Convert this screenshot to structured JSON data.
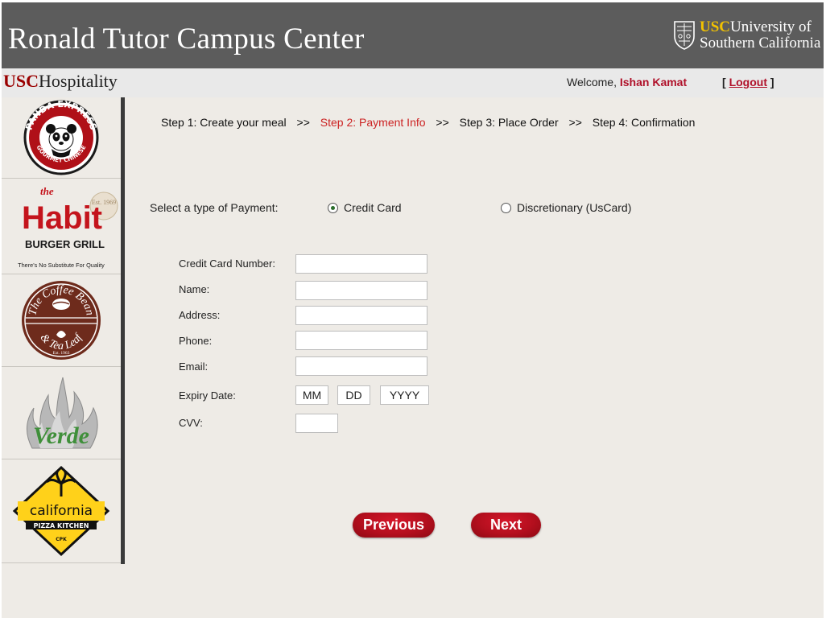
{
  "header": {
    "title": "Ronald Tutor Campus Center",
    "logo_usc": "USC",
    "logo_line1": "University of",
    "logo_line2": "Southern California"
  },
  "subbar": {
    "brand_usc": "USC",
    "brand_name": "Hospitality",
    "welcome_prefix": "Welcome, ",
    "user_name": "Ishan Kamat",
    "logout_open": "[ ",
    "logout_label": "Logout",
    "logout_close": " ]"
  },
  "sidebar": {
    "items": [
      {
        "name": "Panda Express",
        "line1": "PANDA EXPRESS",
        "line2": "GOURMET CHINESE"
      },
      {
        "name": "The Habit",
        "line1": "the",
        "line2": "Habit",
        "line3": "BURGER GRILL",
        "line4": "There's No Substitute For Quality",
        "badge": "Est. 1969"
      },
      {
        "name": "The Coffee Bean & Tea Leaf",
        "line1": "The Coffee Bean",
        "line2": "& Tea Leaf",
        "line3": "Est. 1963"
      },
      {
        "name": "Verde",
        "line1": "Verde"
      },
      {
        "name": "California Pizza Kitchen",
        "line1": "california",
        "line2": "PIZZA KITCHEN",
        "line3": "CPK"
      }
    ]
  },
  "steps": {
    "step1": "Step 1: Create your meal",
    "sep": ">>",
    "step2": "Step 2: Payment Info",
    "step3": "Step 3: Place Order",
    "step4": "Step 4: Confirmation"
  },
  "payment": {
    "label": "Select a type of Payment:",
    "options": [
      "Credit Card",
      "Discretionary (UsCard)"
    ],
    "selected": "Credit Card"
  },
  "form": {
    "card_number_label": "Credit Card Number:",
    "name_label": "Name:",
    "address_label": "Address:",
    "phone_label": "Phone:",
    "email_label": "Email:",
    "expiry_label": "Expiry Date:",
    "cvv_label": "CVV:",
    "mm": "MM",
    "dd": "DD",
    "yyyy": "YYYY"
  },
  "buttons": {
    "previous": "Previous",
    "next": "Next"
  },
  "colors": {
    "header_bg": "#5c5c5c",
    "accent_red": "#b0112a",
    "step_active": "#cc2222",
    "usc_gold": "#f2c200",
    "button_red": "#b40f1e"
  }
}
